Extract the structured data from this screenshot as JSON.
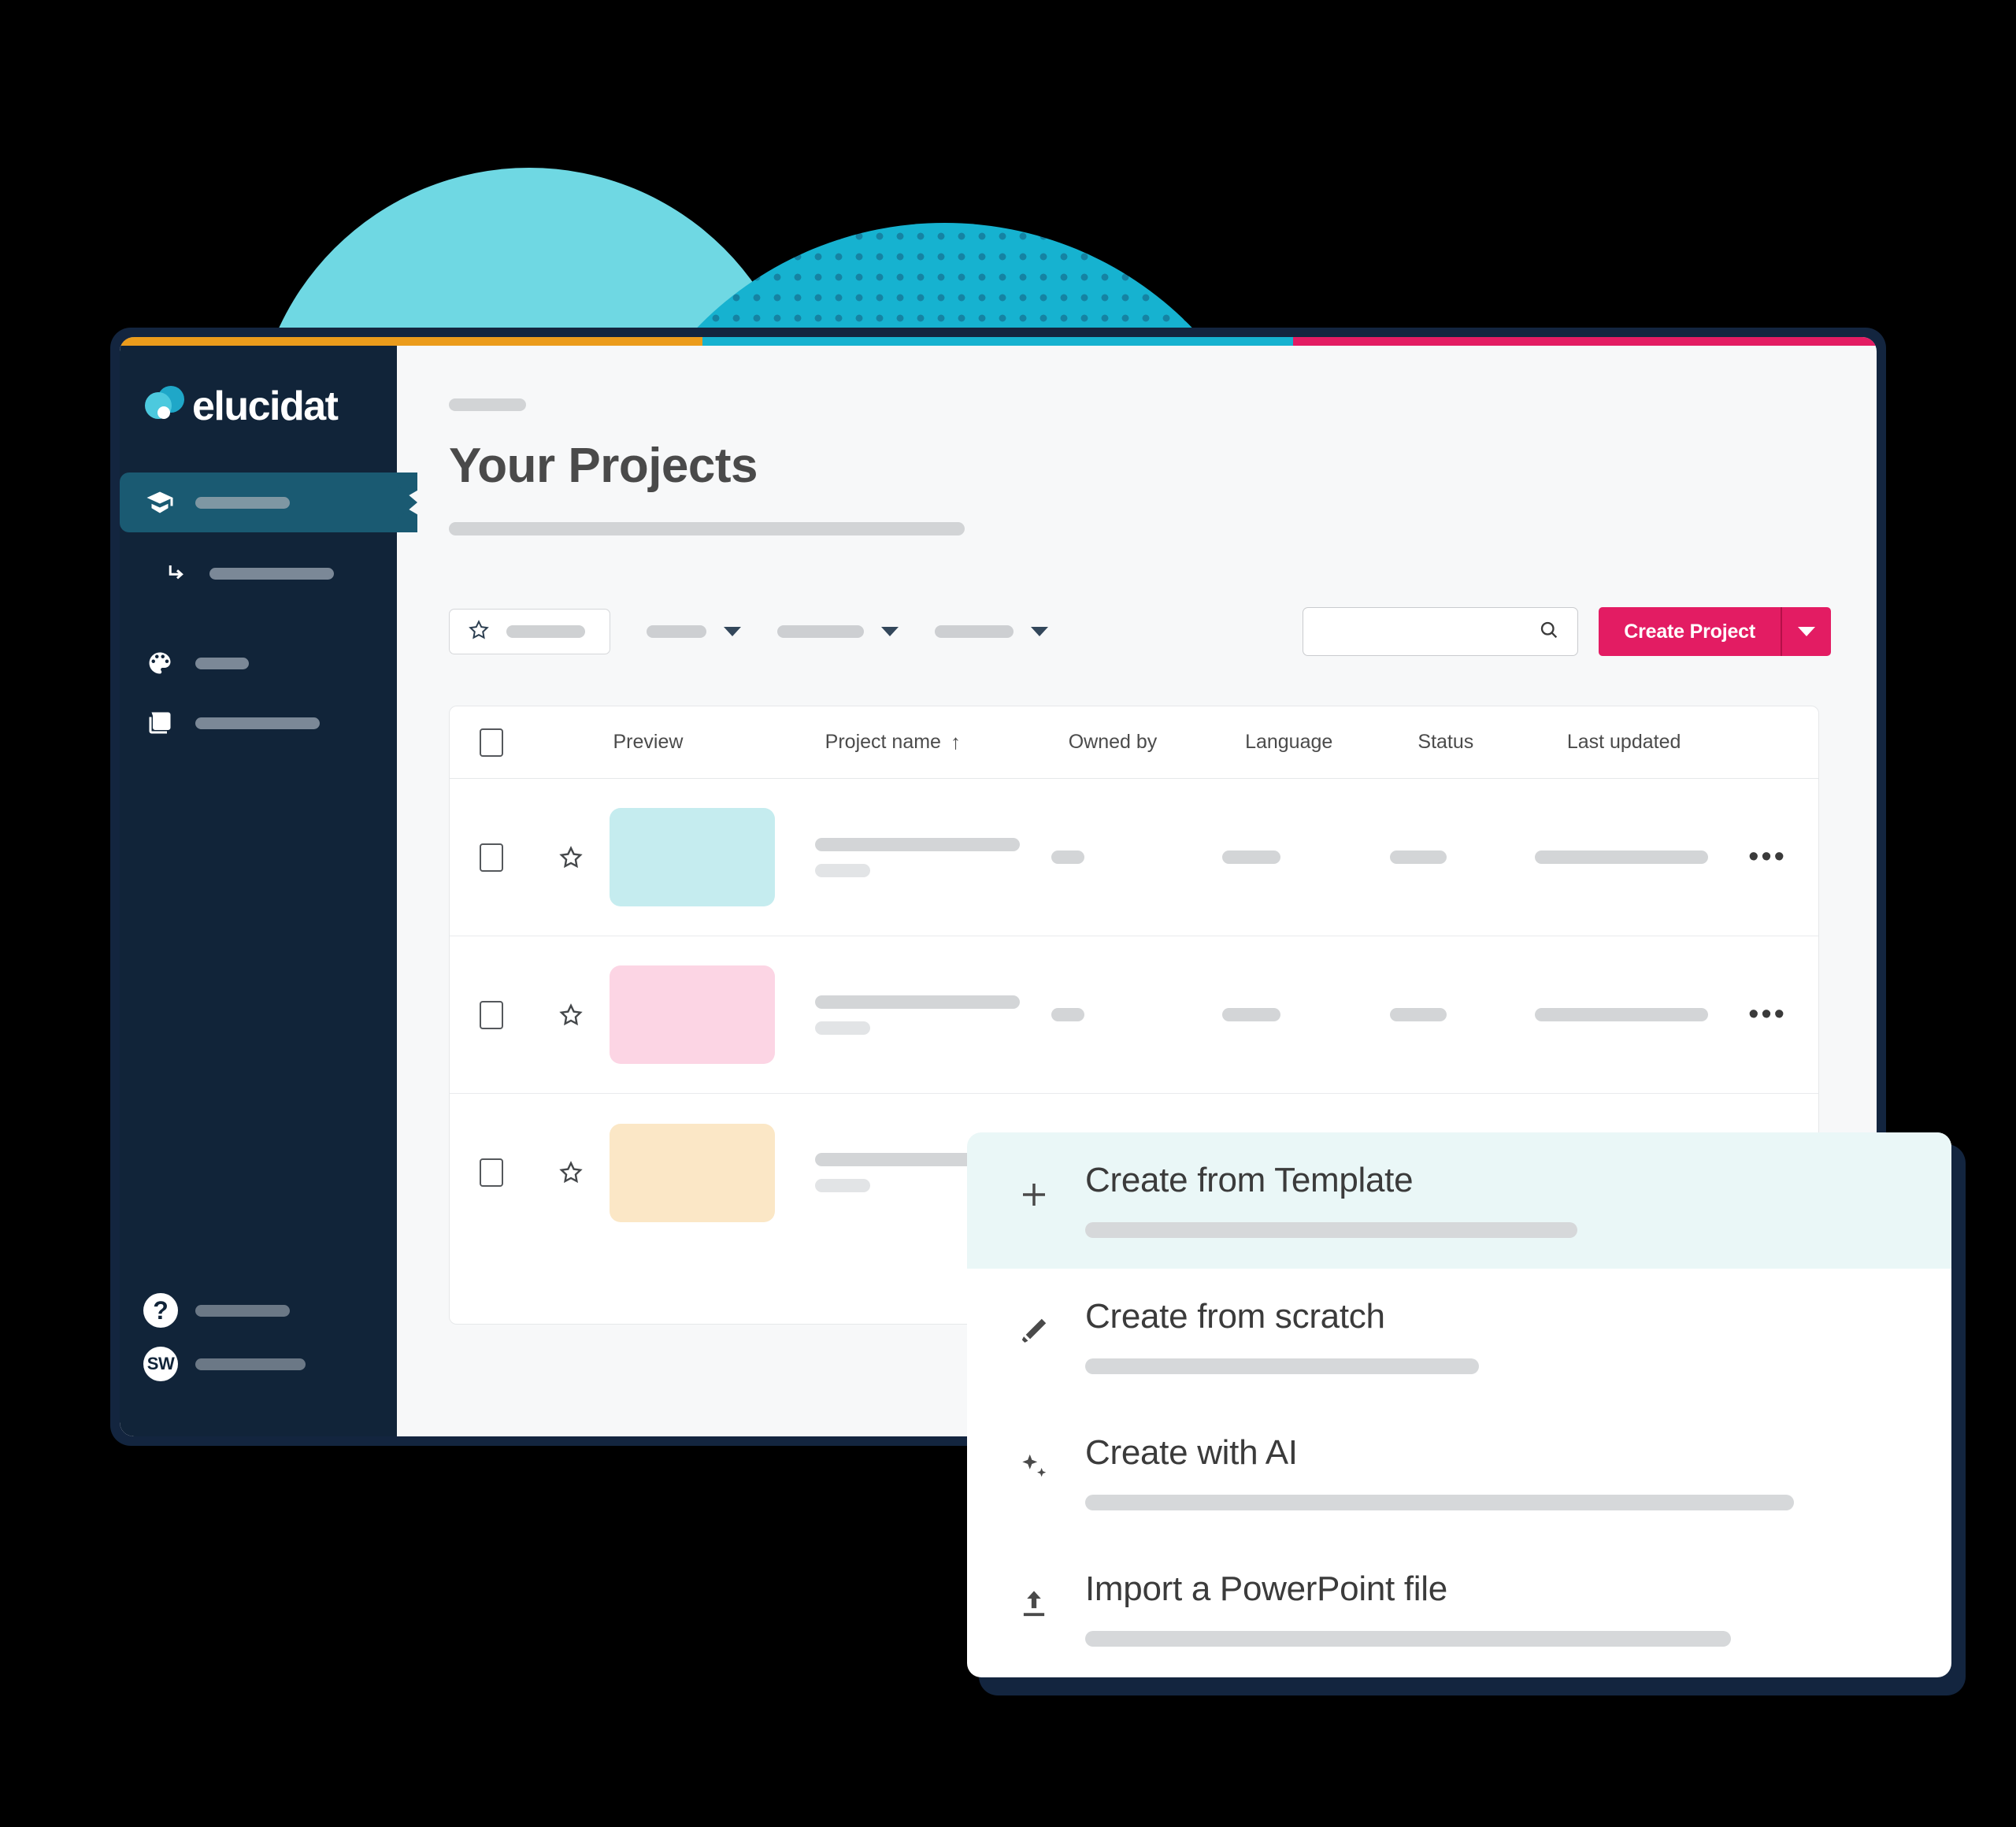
{
  "brand": {
    "name": "elucidat",
    "logo_icon": "elucidat-bubbles-logo"
  },
  "sidebar": {
    "items": [
      {
        "icon": "graduation-cap-icon",
        "label_width": 120,
        "active": true
      },
      {
        "icon": "arrow-branch-icon",
        "label_width": 158,
        "active": false
      },
      {
        "icon": "palette-icon",
        "label_width": 68,
        "active": false
      },
      {
        "icon": "images-icon",
        "label_width": 158,
        "active": false
      }
    ],
    "footer": [
      {
        "badge": "?",
        "icon": "help-icon",
        "label_width": 120
      },
      {
        "badge": "SW",
        "icon": "avatar",
        "label_width": 140
      }
    ]
  },
  "header": {
    "breadcrumb_placeholder": "",
    "title": "Your Projects",
    "subtitle_placeholder": ""
  },
  "toolbar": {
    "favourite_filter": {
      "icon": "star-outline-icon",
      "label_placeholder": ""
    },
    "filters": [
      {
        "width": 76
      },
      {
        "width": 110
      },
      {
        "width": 100
      }
    ],
    "search": {
      "icon": "search-icon",
      "value": "",
      "placeholder": ""
    },
    "create_button": {
      "label": "Create Project",
      "caret_icon": "chevron-down-icon",
      "color": "#e31c63"
    }
  },
  "table": {
    "columns": [
      "Preview",
      "Project name",
      "Owned by",
      "Language",
      "Status",
      "Last updated"
    ],
    "sort": {
      "column": "Project name",
      "direction": "asc",
      "glyph": "↑"
    },
    "select_all_checked": false,
    "rows": [
      {
        "checked": false,
        "starred": false,
        "star_icon": "star-outline-icon",
        "thumbnail_color": "#c5ecef",
        "name_ph_width": 260,
        "meta_ph_width": 70,
        "owner_ph_width": 42,
        "language_ph_width": 74,
        "status_ph_width": 72,
        "updated_ph_width": 220,
        "more_icon": "ellipsis-icon"
      },
      {
        "checked": false,
        "starred": false,
        "star_icon": "star-outline-icon",
        "thumbnail_color": "#fcd5e4",
        "name_ph_width": 260,
        "meta_ph_width": 70,
        "owner_ph_width": 42,
        "language_ph_width": 74,
        "status_ph_width": 72,
        "updated_ph_width": 220,
        "more_icon": "ellipsis-icon"
      },
      {
        "checked": false,
        "starred": false,
        "star_icon": "star-outline-icon",
        "thumbnail_color": "#fbe7c6",
        "name_ph_width": 260,
        "meta_ph_width": 70,
        "owner_ph_width": 42,
        "language_ph_width": 74,
        "status_ph_width": 72,
        "updated_ph_width": 220,
        "more_icon": "ellipsis-icon"
      }
    ]
  },
  "create_menu": {
    "items": [
      {
        "label": "Create from Template",
        "icon": "plus-icon",
        "highlighted": true,
        "desc_ph_width": 625
      },
      {
        "label": "Create from scratch",
        "icon": "magic-wand-icon",
        "highlighted": false,
        "desc_ph_width": 500
      },
      {
        "label": "Create with AI",
        "icon": "sparkles-icon",
        "highlighted": false,
        "desc_ph_width": 900
      },
      {
        "label": "Import a PowerPoint file",
        "icon": "upload-icon",
        "highlighted": false,
        "desc_ph_width": 820
      }
    ]
  },
  "decor": {
    "blob_light_color": "#6fd8e3",
    "blob_dotted_color": "#16b2d0",
    "blob_dot_color": "#1583a3",
    "accent_orange": "#eb9c1c",
    "accent_teal": "#16b2d0",
    "accent_pink": "#e31c63"
  }
}
